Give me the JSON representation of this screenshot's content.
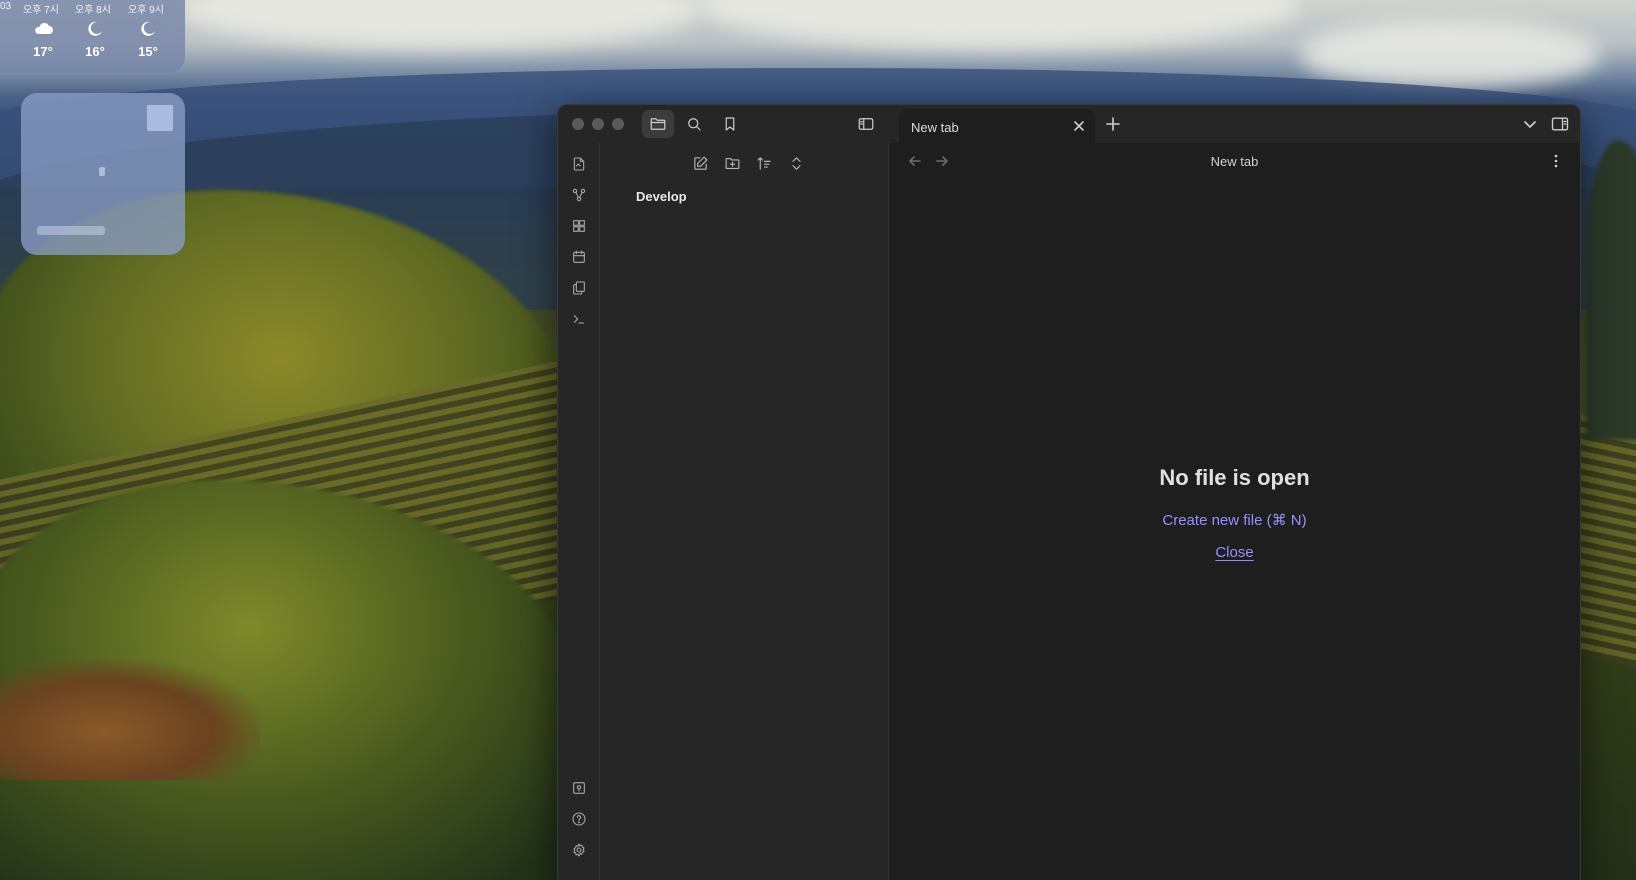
{
  "weather_widget": {
    "partial_hour": "03",
    "hours": [
      {
        "label": "오후 7시",
        "icon": "cloudy-night-icon",
        "temp": "17°"
      },
      {
        "label": "오후 8시",
        "icon": "moon-icon",
        "temp": "16°"
      },
      {
        "label": "오후 9시",
        "icon": "moon-icon",
        "temp": "15°"
      }
    ]
  },
  "toolbar": {
    "file_explorer_icon": "folder-icon",
    "search_icon": "search-icon",
    "bookmarks_icon": "bookmark-icon",
    "sidebar_toggle_icon": "sidebar-toggle-icon"
  },
  "ribbon": {
    "top_icons": [
      "open-quick-switcher-icon",
      "graph-view-icon",
      "canvas-icon",
      "daily-note-icon",
      "templates-icon",
      "command-palette-icon"
    ],
    "bottom_icons": [
      "vault-switcher-icon",
      "help-icon",
      "settings-icon"
    ]
  },
  "file_panel": {
    "vault_name": "Develop",
    "tools": [
      "new-note-icon",
      "new-folder-icon",
      "sort-icon",
      "collapse-all-icon"
    ]
  },
  "tabs": [
    {
      "title": "New tab"
    }
  ],
  "view": {
    "title": "New tab",
    "empty_title": "No file is open",
    "create_action": "Create new file (⌘ N)",
    "close_action": "Close"
  },
  "colors": {
    "accent": "#9b8eff",
    "background": "#1e1e1e",
    "panel": "#262626"
  }
}
